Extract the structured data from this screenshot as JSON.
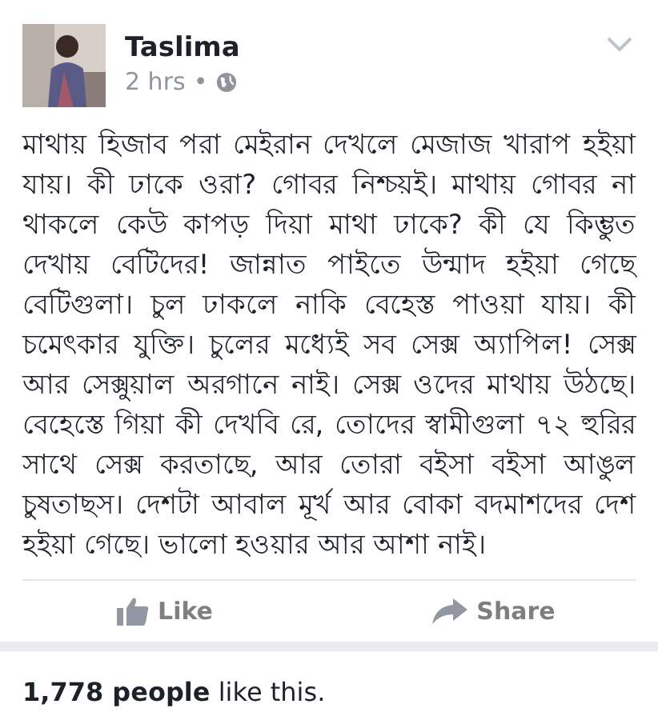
{
  "post": {
    "author": "Taslima",
    "time": "2 hrs",
    "separator": "•",
    "body": "মাথায় হিজাব পরা মেইরান দেখলে মেজাজ খারাপ হইয়া যায়। কী ঢাকে ওরা? গোবর নিশ্চয়ই।  মাথায় গোবর না থাকলে কেউ কাপড় দিয়া মাথা ঢাকে? কী যে কিম্ভুত দেখায় বেটিদের! জান্নাত পাইতে উন্মাদ হইয়া গেছে বেটিগুলা। চুল ঢাকলে নাকি বেহেস্ত পাওয়া যায়। কী চমেৎকার যুক্তি। চুলের মধ্যেই সব সেক্স অ্যাপিল! সেক্স আর সেক্সুয়াল অরগানে নাই। সেক্স ওদের মাথায় উঠছে। বেহেস্তে  গিয়া কী দেখবি রে, তোদের স্বামীগুলা ৭২ হুরির সাথে সেক্স করতাছে, আর তোরা বইসা বইসা আঙুল চুষতাছস। দেশটা আবাল মূর্খ আর বোকা বদমাশদের দেশ হইয়া গেছে। ভালো হওয়ার আর আশা নাই।",
    "actions": [
      {
        "kind": "like",
        "label": "Like"
      },
      {
        "kind": "share",
        "label": "Share"
      }
    ],
    "likes": "**1,778 people** like this."
  }
}
